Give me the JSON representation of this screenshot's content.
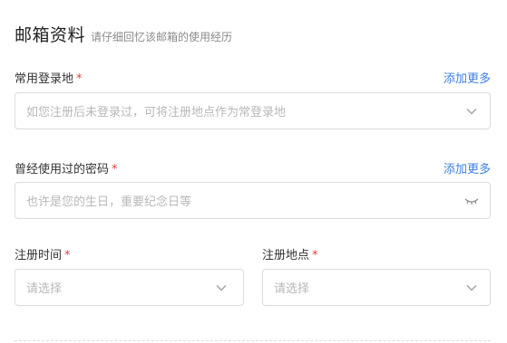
{
  "header": {
    "title": "邮箱资料",
    "subtitle": "请仔细回忆该邮箱的使用经历"
  },
  "login_location": {
    "label": "常用登录地",
    "required_mark": "*",
    "add_more": "添加更多",
    "placeholder": "如您注册后未登录过，可将注册地点作为常登录地",
    "icon": "chevron-down-icon"
  },
  "password": {
    "label": "曾经使用过的密码",
    "required_mark": "*",
    "add_more": "添加更多",
    "placeholder": "也许是您的生日，重要纪念日等",
    "icon": "eye-closed-icon"
  },
  "register_time": {
    "label": "注册时间",
    "required_mark": "*",
    "placeholder": "请选择",
    "icon": "chevron-down-icon"
  },
  "register_place": {
    "label": "注册地点",
    "required_mark": "*",
    "placeholder": "请选择",
    "icon": "chevron-down-icon"
  },
  "colors": {
    "link": "#3d7fe3",
    "required": "#e0433e",
    "border": "#dcdcdc",
    "placeholder": "#b8b8b8"
  }
}
